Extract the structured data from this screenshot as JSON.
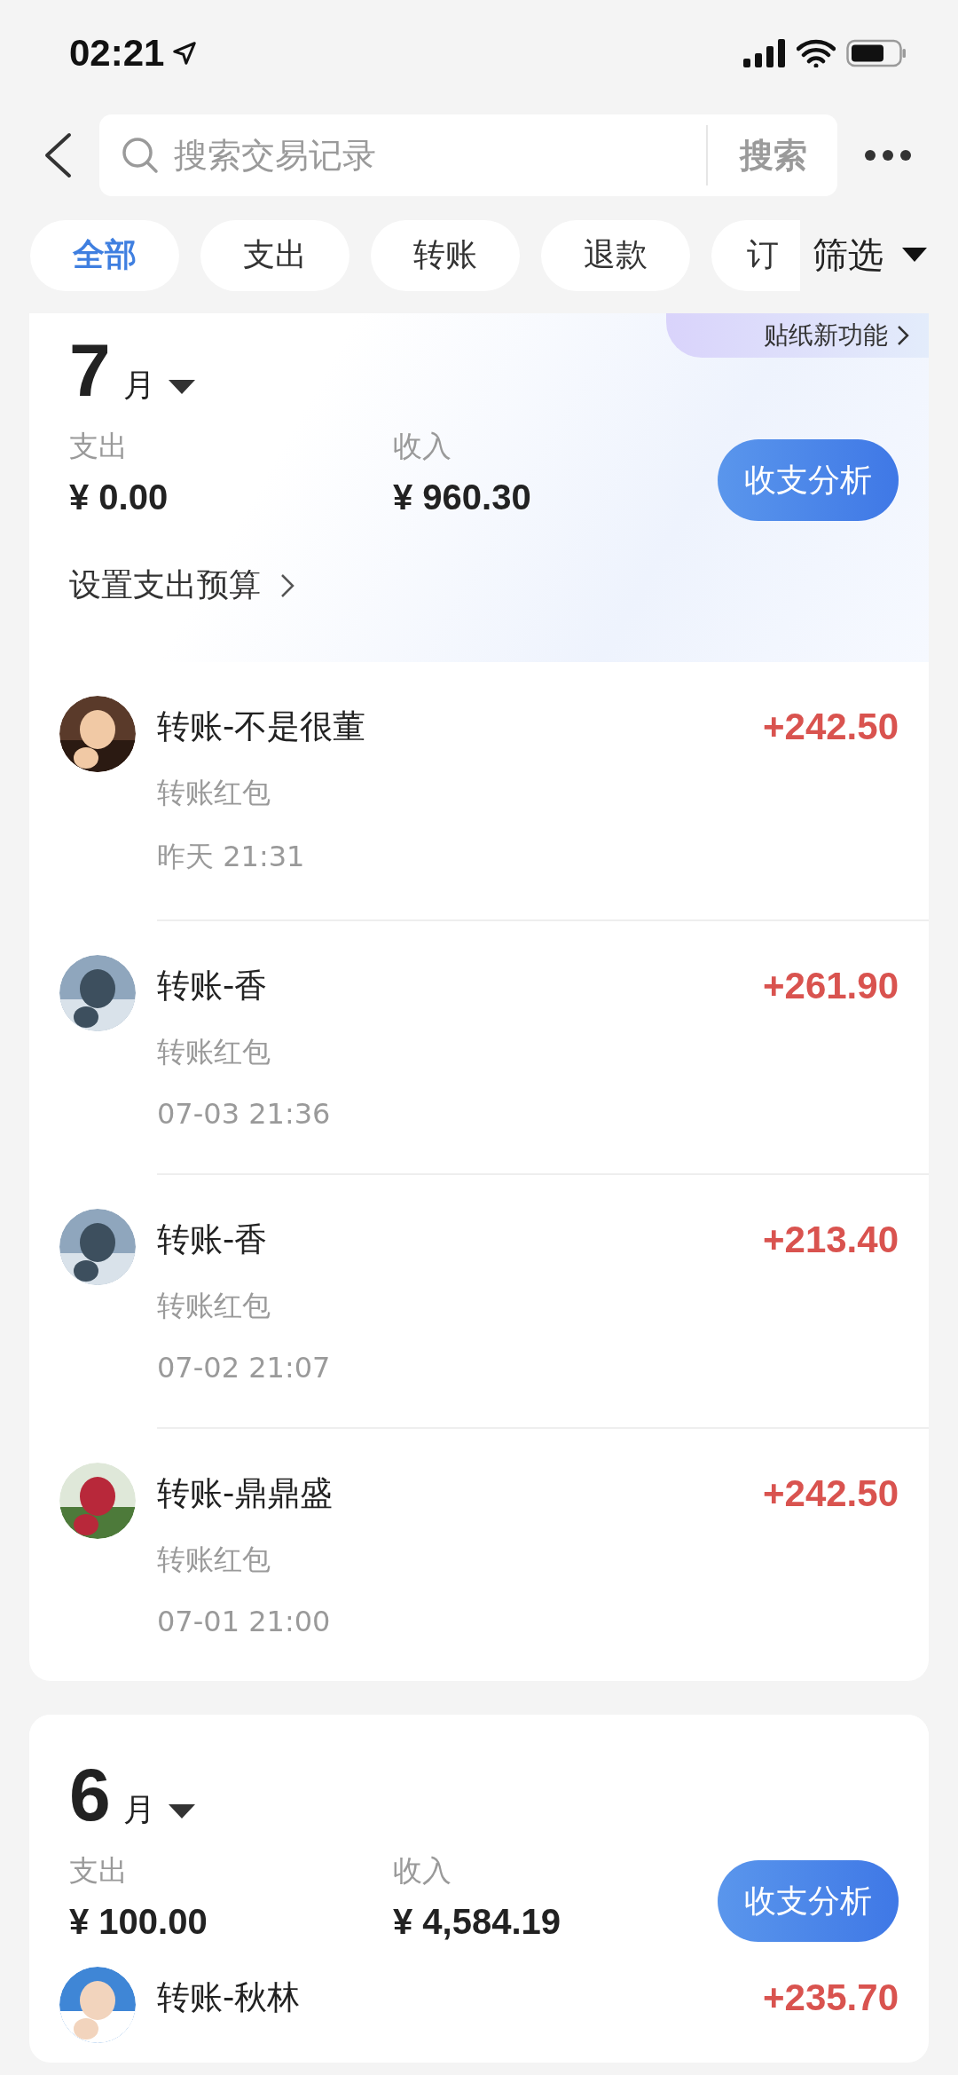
{
  "status_bar": {
    "time": "02:21"
  },
  "search": {
    "placeholder": "搜索交易记录",
    "button": "搜索"
  },
  "tabs": [
    {
      "label": "全部",
      "selected": true
    },
    {
      "label": "支出",
      "selected": false
    },
    {
      "label": "转账",
      "selected": false
    },
    {
      "label": "退款",
      "selected": false
    },
    {
      "label": "订",
      "selected": false
    }
  ],
  "filter": "筛选",
  "sticker_banner": "贴纸新功能",
  "months": [
    {
      "month": "7",
      "unit": "月",
      "expense_label": "支出",
      "expense": "¥ 0.00",
      "income_label": "收入",
      "income": "¥ 960.30",
      "budget_link": "设置支出预算",
      "analysis_button": "收支分析",
      "rows": [
        {
          "title": "转账-不是很董",
          "subtitle": "转账红包",
          "time": "昨天 21:31",
          "amount": "+242.50"
        },
        {
          "title": "转账-香",
          "subtitle": "转账红包",
          "time": "07-03 21:36",
          "amount": "+261.90"
        },
        {
          "title": "转账-香",
          "subtitle": "转账红包",
          "time": "07-02 21:07",
          "amount": "+213.40"
        },
        {
          "title": "转账-鼎鼎盛",
          "subtitle": "转账红包",
          "time": "07-01 21:00",
          "amount": "+242.50"
        }
      ]
    },
    {
      "month": "6",
      "unit": "月",
      "expense_label": "支出",
      "expense": "¥ 100.00",
      "income_label": "收入",
      "income": "¥ 4,584.19",
      "analysis_button": "收支分析",
      "rows": [
        {
          "title": "转账-秋林",
          "amount": "+235.70"
        }
      ]
    }
  ]
}
